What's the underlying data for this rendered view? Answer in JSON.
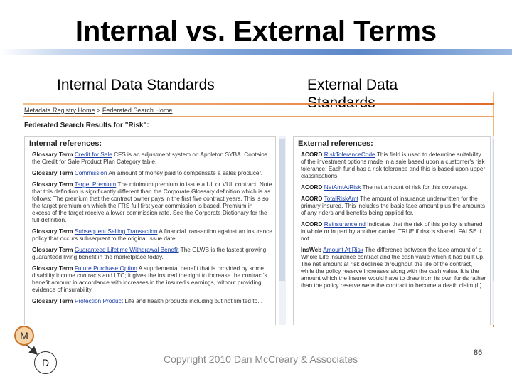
{
  "slide": {
    "title": "Internal vs. External Terms",
    "col_left": "Internal Data Standards",
    "col_right": "External Data Standards",
    "copyright": "Copyright 2010 Dan McCreary & Associates",
    "page_number": "86"
  },
  "panel": {
    "nav_home": "Metadata Registry Home",
    "nav_sep": ">",
    "nav_current": "Federated Search Home",
    "results_heading": "Federated Search Results for \"Risk\":",
    "internal": {
      "heading": "Internal references:",
      "entries": [
        {
          "kind": "Glossary Term",
          "term": "Credit for Sale",
          "desc": "CFS is an adjustment system on Appleton SYBA. Contains the Credit for Sale Product Plan Category table."
        },
        {
          "kind": "Glossary Term",
          "term": "Commission",
          "desc": "An amount of money paid to compensate a sales producer."
        },
        {
          "kind": "Glossary Term",
          "term": "Target Premium",
          "desc": "The minimum premium to issue a UL or VUL contract. Note that this definition is significantly different than the Corporate Glossary definition which is as follows: The premium that the contract owner pays in the first five contract years. This is so the target premium on which the FRS full first year commission is based. Premium in excess of the target receive a lower commission rate. See the Corporate Dictionary for the full definition."
        },
        {
          "kind": "Glossary Term",
          "term": "Subsequent Selling Transaction",
          "desc": "A financial transaction against an insurance policy that occurs subsequent to the original issue date."
        },
        {
          "kind": "Glossary Term",
          "term": "Guaranteed Lifetime Withdrawal Benefit",
          "desc": "The GLWB is the fastest growing guaranteed living benefit in the marketplace today."
        },
        {
          "kind": "Glossary Term",
          "term": "Future Purchase Option",
          "desc": "A supplemental benefit that is provided by some disability income contracts and LTC; it gives the insured the right to increase the contract's benefit amount in accordance with increases in the insured's earnings, without providing evidence of insurability."
        },
        {
          "kind": "Glossary Term",
          "term": "Protection Product",
          "desc": "Life and health products including but not limited to..."
        }
      ]
    },
    "external": {
      "heading": "External references:",
      "entries": [
        {
          "kind": "ACORD",
          "term": "RiskToleranceCode",
          "desc": "This field is used to determine suitability of the investment options made in a sale based upon a customer's risk tolerance. Each fund has a risk tolerance and this is based upon upper classifications."
        },
        {
          "kind": "ACORD",
          "term": "NetAmtAtRisk",
          "desc": "The net amount of risk for this coverage."
        },
        {
          "kind": "ACORD",
          "term": "TotalRiskAmt",
          "desc": "The amount of insurance underwritten for the primary insured. This includes the basic face amount plus the amounts of any riders and benefits being applied for."
        },
        {
          "kind": "ACORD",
          "term": "ReinsuranceInd",
          "desc": "Indicates that the risk of this policy is shared in whole or in part by another carrier. TRUE if risk is shared. FALSE if not."
        },
        {
          "kind": "InsWeb",
          "term": "Amount At Risk",
          "desc": "The difference between the face amount of a Whole Life insurance contract and the cash value which it has built up. The net amount at risk declines throughout the life of the contract, while the policy reserve increases along with the cash value. It is the amount which the insurer would have to draw from its own funds rather than the policy reserve were the contract to become a death claim (L)."
        }
      ]
    }
  },
  "diagram": {
    "node_m": "M",
    "node_d": "D"
  }
}
